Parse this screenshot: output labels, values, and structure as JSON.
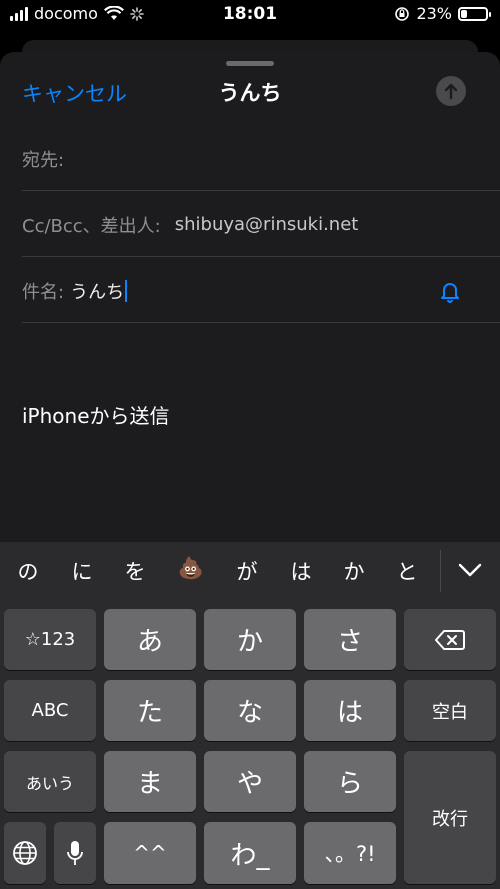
{
  "status": {
    "carrier": "docomo",
    "time": "18:01",
    "battery_percent": "23%",
    "battery_level": 0.23
  },
  "compose": {
    "cancel_label": "キャンセル",
    "title": "うんち",
    "to_label": "宛先:",
    "to_value": "",
    "cc_label": "Cc/Bcc、差出人:",
    "cc_value": "shibuya@rinsuki.net",
    "subject_label": "件名:",
    "subject_value": "うんち",
    "signature": "iPhoneから送信"
  },
  "keyboard": {
    "candidates": [
      "の",
      "に",
      "を",
      "💩",
      "が",
      "は",
      "か",
      "と"
    ],
    "keys": {
      "num": "☆123",
      "a": "あ",
      "ka": "か",
      "sa": "さ",
      "abc": "ABC",
      "ta": "た",
      "na": "な",
      "ha": "は",
      "space": "空白",
      "aiu": "あいう",
      "ma": "ま",
      "ya": "や",
      "ra": "ら",
      "enter": "改行",
      "dakuten": "^^",
      "wa": "わ_",
      "punct": "、。?!"
    }
  },
  "colors": {
    "accent": "#0a84ff",
    "sheet": "#1c1c1e",
    "key_light": "#6b6b6e",
    "key_dark": "#464648"
  }
}
